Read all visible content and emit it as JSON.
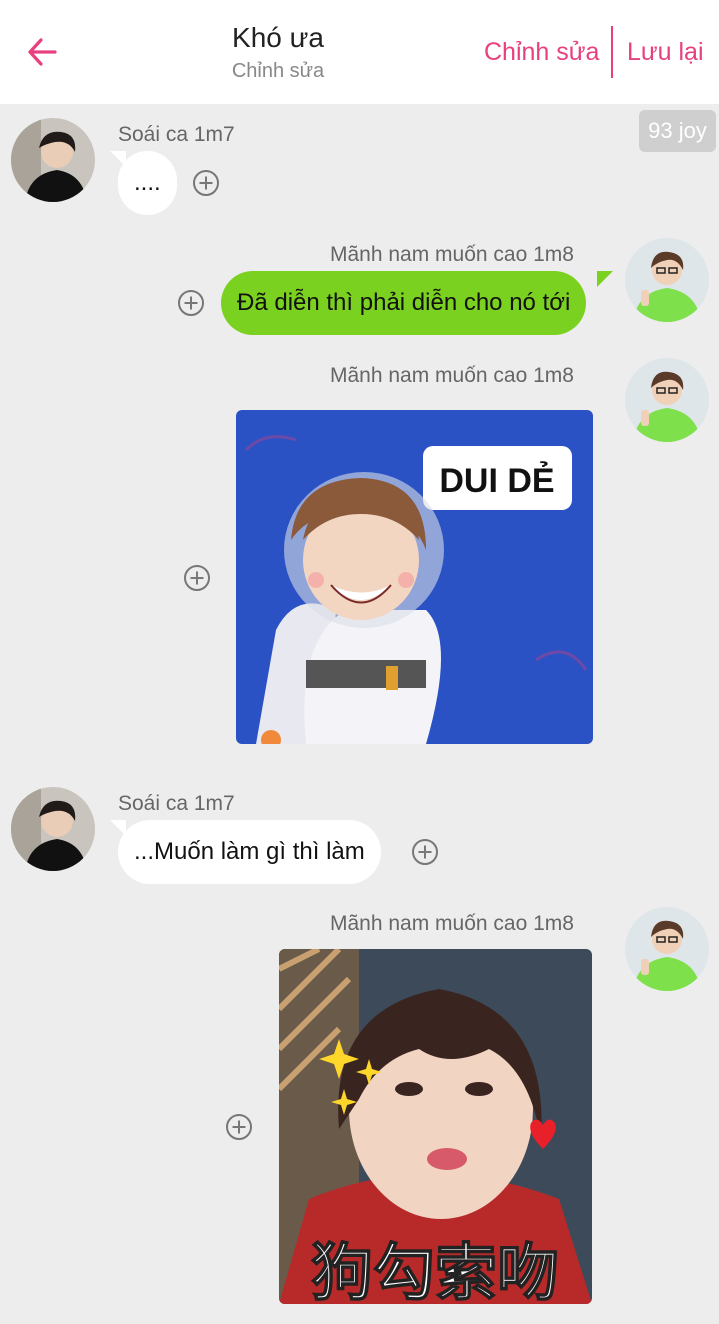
{
  "header": {
    "title": "Khó ưa",
    "subtitle": "Chỉnh sửa",
    "edit_label": "Chỉnh sửa",
    "save_label": "Lưu lại",
    "accent_color": "#e8407f"
  },
  "badge": {
    "text": "93 joy"
  },
  "senders": {
    "left": "Soái ca 1m7",
    "right": "Mãnh nam muốn cao 1m8"
  },
  "messages": [
    {
      "side": "left",
      "type": "text",
      "sender": "Soái ca 1m7",
      "text": "...."
    },
    {
      "side": "right",
      "type": "text",
      "sender": "Mãnh nam muốn cao 1m8",
      "text": "Đã diễn thì phải diễn cho nó tới"
    },
    {
      "side": "right",
      "type": "sticker",
      "sender": "Mãnh nam muốn cao 1m8",
      "sticker_text": "DUI DẺ"
    },
    {
      "side": "left",
      "type": "text",
      "sender": "Soái ca 1m7",
      "text": "...Muốn làm gì thì làm"
    },
    {
      "side": "right",
      "type": "sticker",
      "sender": "Mãnh nam muốn cao 1m8",
      "sticker_text": "狗勾索吻"
    }
  ],
  "colors": {
    "bubble_right": "#7bd11f",
    "bubble_left": "#ffffff",
    "background": "#ededed"
  },
  "icons": [
    "back-arrow-icon",
    "plus-circle-icon"
  ]
}
